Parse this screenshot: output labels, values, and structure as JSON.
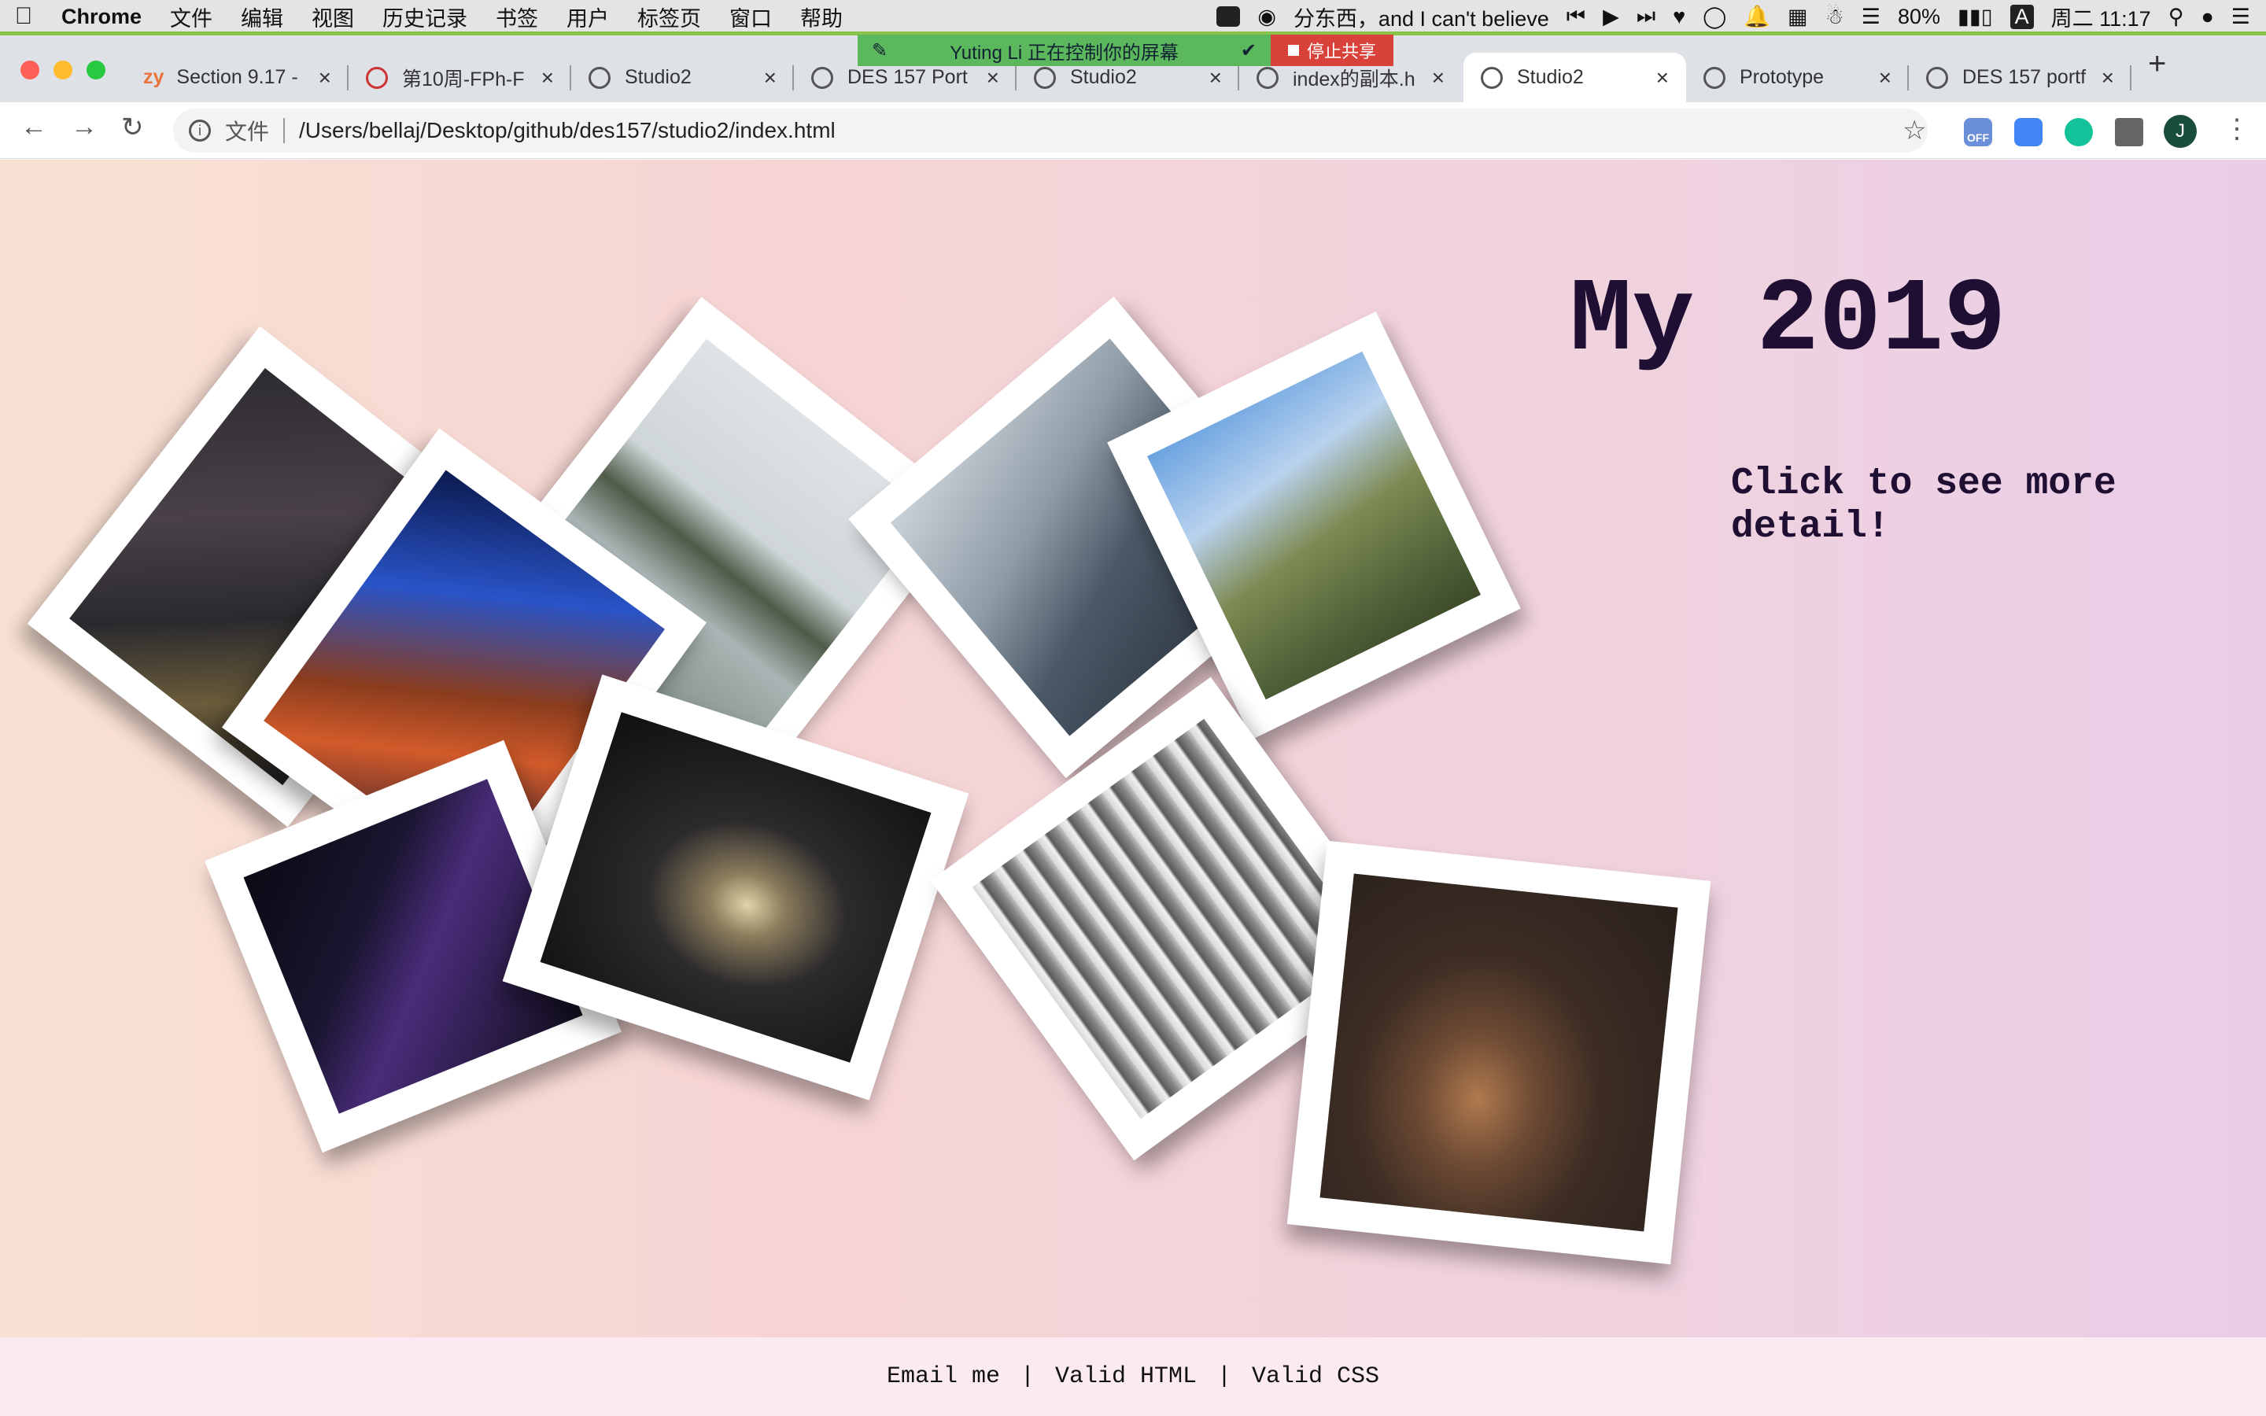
{
  "menubar": {
    "app": "Chrome",
    "items": [
      "文件",
      "编辑",
      "视图",
      "历史记录",
      "书签",
      "用户",
      "标签页",
      "窗口",
      "帮助"
    ],
    "now_playing": "分东西，and I can't believe",
    "battery": "80%",
    "input_method": "A",
    "clock": "周二 11:17"
  },
  "share_banner": {
    "message": "Yuting Li 正在控制你的屏幕",
    "stop_label": "停止共享"
  },
  "tabs": [
    {
      "label": "Section 9.17 -"
    },
    {
      "label": "第10周-FPh-F"
    },
    {
      "label": "Studio2"
    },
    {
      "label": "DES 157 Port"
    },
    {
      "label": "Studio2"
    },
    {
      "label": "index的副本.h"
    },
    {
      "label": "Studio2"
    },
    {
      "label": "Prototype"
    },
    {
      "label": "DES 157 portf"
    }
  ],
  "address": {
    "file_label": "文件",
    "url": "/Users/bellaj/Desktop/github/des157/studio2/index.html"
  },
  "extensions": {
    "off_badge": "OFF"
  },
  "profile_initial": "J",
  "page": {
    "title": "My 2019",
    "subtitle": "Click to see more detail!",
    "photos": [
      "night-street-sign",
      "concert-stage-apologetic",
      "angkor-wat-reflection",
      "misty-karst-mountains",
      "mountain-valley-clouds",
      "purple-concert-lights",
      "dark-theater-stage",
      "birch-forest-bw",
      "cat-in-dark-room"
    ]
  },
  "footer": {
    "links": [
      "Email me",
      "Valid HTML",
      "Valid CSS"
    ],
    "separator": "|"
  },
  "colors": {
    "title": "#1e0f33",
    "accent_green": "#5cb85c",
    "stop_red": "#d9423a"
  }
}
